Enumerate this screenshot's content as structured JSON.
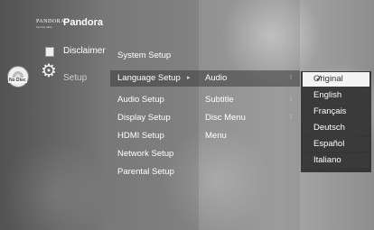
{
  "left_menu": {
    "brand_logo_text": "PANDORA",
    "brand_tagline": "internet radio",
    "pandora_label": "Pandora",
    "disclaimer_label": "Disclaimer",
    "setup_label": "Setup",
    "no_disc_label": "No Disc"
  },
  "setup_menu": {
    "items": [
      {
        "label": "System Setup"
      },
      {
        "label": "Language Setup"
      },
      {
        "label": "Audio Setup"
      },
      {
        "label": "Display Setup"
      },
      {
        "label": "HDMI Setup"
      },
      {
        "label": "Network Setup"
      },
      {
        "label": "Parental Setup"
      }
    ],
    "selected_index": 1
  },
  "language_menu": {
    "items": [
      {
        "label": "Audio"
      },
      {
        "label": "Subtitle"
      },
      {
        "label": "Disc Menu"
      },
      {
        "label": "Menu"
      }
    ]
  },
  "audio_dropdown": {
    "options": [
      {
        "label": "Original",
        "selected": true
      },
      {
        "label": "English"
      },
      {
        "label": "Français"
      },
      {
        "label": "Deutsch"
      },
      {
        "label": "Español"
      },
      {
        "label": "Italiano"
      }
    ]
  },
  "colors": {
    "highlight": "#3c3c3c",
    "selected_option_bg": "#f4f4f4",
    "option_bg": "#3a3a3a"
  }
}
